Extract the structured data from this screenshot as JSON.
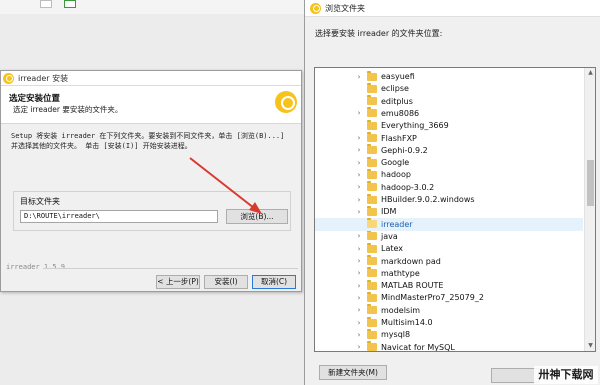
{
  "installer": {
    "title": "irreader 安装",
    "header_title": "选定安装位置",
    "header_subtitle": "选定 irreader 要安装的文件夹。",
    "description": "Setup 将安装 irreader 在下列文件夹。要安装到不同文件夹，单击 [浏览(B)...]\n并选择其他的文件夹。 单击 [安装(I)] 开始安装进程。",
    "dest_group_label": "目标文件夹",
    "dest_path": "D:\\ROUTE\\irreader\\",
    "browse_button": "浏览(B)...",
    "version": "irreader 1.5.9",
    "back_button": "< 上一步(P)",
    "install_button": "安装(I)",
    "cancel_button": "取消(C)"
  },
  "dialog": {
    "title": "浏览文件夹",
    "prompt": "选择要安装 irreader 的文件夹位置:",
    "new_folder_button": "新建文件夹(M)",
    "folders": [
      {
        "name": "easyuefi",
        "has_children": true
      },
      {
        "name": "eclipse",
        "has_children": false
      },
      {
        "name": "editplus",
        "has_children": false
      },
      {
        "name": "emu8086",
        "has_children": true
      },
      {
        "name": "Everything_3669",
        "has_children": false
      },
      {
        "name": "FlashFXP",
        "has_children": true
      },
      {
        "name": "Gephi-0.9.2",
        "has_children": true
      },
      {
        "name": "Google",
        "has_children": true
      },
      {
        "name": "hadoop",
        "has_children": true
      },
      {
        "name": "hadoop-3.0.2",
        "has_children": true
      },
      {
        "name": "HBuilder.9.0.2.windows",
        "has_children": true
      },
      {
        "name": "IDM",
        "has_children": true
      },
      {
        "name": "irreader",
        "has_children": false,
        "selected": true
      },
      {
        "name": "java",
        "has_children": true
      },
      {
        "name": "Latex",
        "has_children": true
      },
      {
        "name": "markdown pad",
        "has_children": true
      },
      {
        "name": "mathtype",
        "has_children": true
      },
      {
        "name": "MATLAB ROUTE",
        "has_children": true
      },
      {
        "name": "MindMasterPro7_25079_2",
        "has_children": true
      },
      {
        "name": "modelsim",
        "has_children": true
      },
      {
        "name": "Multisim14.0",
        "has_children": true
      },
      {
        "name": "mysql8",
        "has_children": true
      },
      {
        "name": "Navicat for MySQL",
        "has_children": true
      }
    ]
  },
  "watermark": "卅神下载网",
  "colors": {
    "accent_red": "#d93a2f",
    "logo_yellow": "#f6c21b",
    "selected_text": "#1a5fb4"
  },
  "icons": {
    "folder": "folder-icon",
    "chevron": "chevron-right-icon",
    "logo": "irreader-logo-icon"
  }
}
